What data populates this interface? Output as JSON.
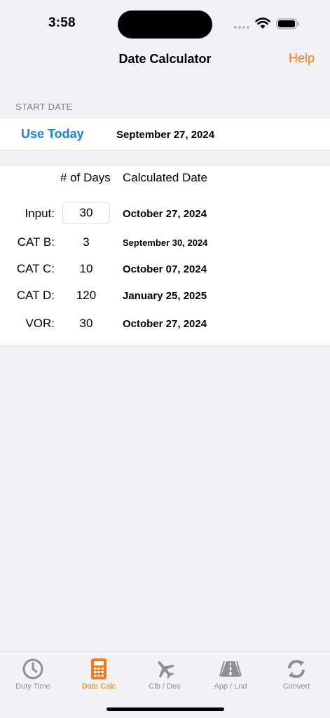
{
  "status": {
    "time": "3:58",
    "wifi_icon": "wifi-icon",
    "battery_icon": "battery-icon"
  },
  "nav": {
    "title": "Date Calculator",
    "help_label": "Help"
  },
  "start": {
    "section_label": "START DATE",
    "use_today_label": "Use Today",
    "date": "September 27, 2024"
  },
  "calc": {
    "header_days": "# of Days",
    "header_date": "Calculated Date",
    "rows": [
      {
        "label": "Input:",
        "days": "30",
        "date": "October 27, 2024"
      },
      {
        "label": "CAT B:",
        "days": "3",
        "date": "September 30, 2024"
      },
      {
        "label": "CAT C:",
        "days": "10",
        "date": "October 07, 2024"
      },
      {
        "label": "CAT D:",
        "days": "120",
        "date": "January 25, 2025"
      },
      {
        "label": "VOR:",
        "days": "30",
        "date": "October 27, 2024"
      }
    ]
  },
  "tabs": [
    {
      "label": "Duty Time",
      "icon": "clock-icon",
      "active": false
    },
    {
      "label": "Date Calc",
      "icon": "calculator-icon",
      "active": true
    },
    {
      "label": "Clb / Des",
      "icon": "airplane-icon",
      "active": false
    },
    {
      "label": "App / Lnd",
      "icon": "runway-icon",
      "active": false
    },
    {
      "label": "Convert",
      "icon": "refresh-icon",
      "active": false
    }
  ],
  "colors": {
    "accent": "#f07a1e",
    "link": "#1a7fe6",
    "inactive_icon": "#8e8e93"
  }
}
